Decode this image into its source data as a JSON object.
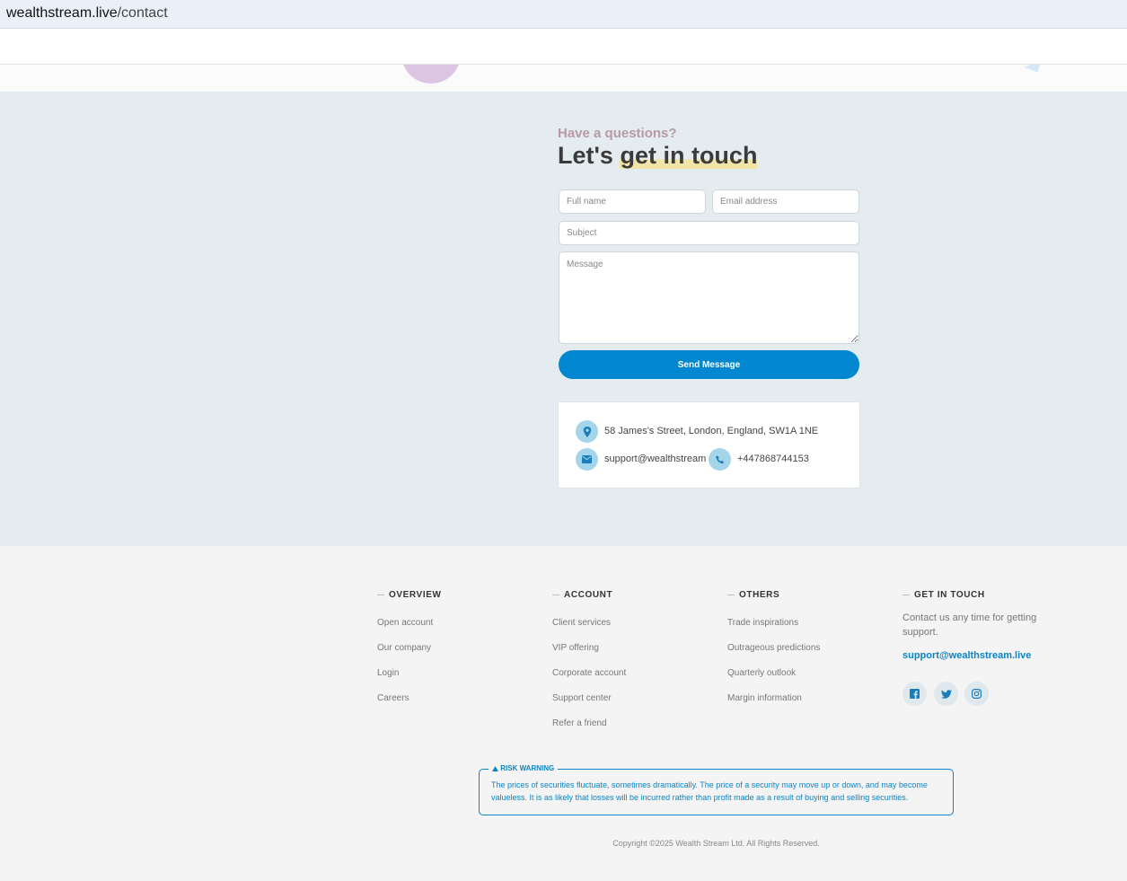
{
  "browser": {
    "domain": "wealthstream.live",
    "path": "/contact"
  },
  "contact": {
    "eyebrow": "Have a questions?",
    "heading_start": "Let's ",
    "heading_highlight": "get in touch",
    "form": {
      "full_name_placeholder": "Full name",
      "email_placeholder": "Email address",
      "subject_placeholder": "Subject",
      "message_placeholder": "Message",
      "send_label": "Send Message"
    },
    "info": {
      "address": "58 James's Street, London, England, SW1A 1NE",
      "email": "support@wealthstream",
      "phone": "+447868744153"
    }
  },
  "footer": {
    "columns": [
      {
        "title": "OVERVIEW",
        "links": [
          "Open account",
          "Our company",
          "Login",
          "Careers"
        ]
      },
      {
        "title": "ACCOUNT",
        "links": [
          "Client services",
          "VIP offering",
          "Corporate account",
          "Support center",
          "Refer a friend"
        ]
      },
      {
        "title": "OTHERS",
        "links": [
          "Trade inspirations",
          "Outrageous predictions",
          "Quarterly outlook",
          "Margin information"
        ]
      }
    ],
    "get_in_touch": {
      "title": "GET IN TOUCH",
      "text": "Contact us any time for getting support.",
      "email": "support@wealthstream.live",
      "socials": [
        "facebook-icon",
        "twitter-icon",
        "instagram-icon"
      ]
    },
    "risk_warning": {
      "label": "RISK WARNING",
      "text": "The prices of securities fluctuate, sometimes dramatically. The price of a security may move up or down, and may become valueless. It is as likely that losses will be incurred rather than profit made as a result of buying and selling securities."
    },
    "copyright": "Copyright ©2025 Wealth Stream Ltd. All Rights Reserved."
  },
  "colors": {
    "accent": "#0087d0",
    "section_bg": "#e4ecf0",
    "icon_bg": "#a5d5ea"
  }
}
